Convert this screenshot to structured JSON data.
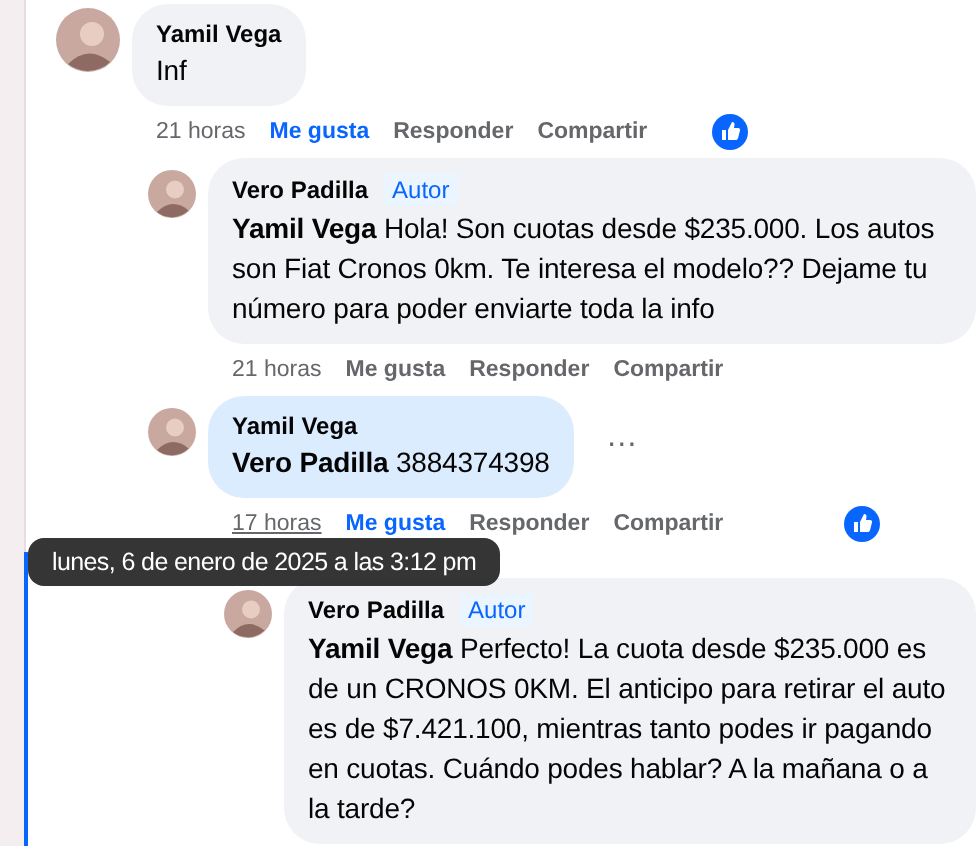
{
  "comments": [
    {
      "author": "Yamil Vega",
      "text": "Inf",
      "highlighted": false,
      "time": "21 horas",
      "time_hovered": false,
      "like": "Me gusta",
      "liked": true,
      "reply": "Responder",
      "share": "Compartir",
      "has_reaction": true,
      "children": [
        {
          "author": "Vero Padilla",
          "badge": "Autor",
          "text": "**Yamil Vega** Hola! Son cuotas desde $235.000. Los autos son Fiat Cronos 0km. Te interesa el modelo?? Dejame tu número para poder enviarte toda la info",
          "highlighted": false,
          "time": "21 horas",
          "time_hovered": false,
          "like": "Me gusta",
          "liked": false,
          "reply": "Responder",
          "share": "Compartir",
          "has_reaction": false
        },
        {
          "author": "Yamil Vega",
          "text": "**Vero Padilla** 3884374398",
          "highlighted": true,
          "time": "17 horas",
          "time_hovered": true,
          "like": "Me gusta",
          "liked": true,
          "reply": "Responder",
          "share": "Compartir",
          "has_reaction": true,
          "menu": "…",
          "children": [
            {
              "author": "Vero Padilla",
              "badge": "Autor",
              "text": "**Yamil Vega** Perfecto! La cuota desde $235.000 es de un CRONOS 0KM. El anticipo para retirar el auto es de $7.421.100, mientras tanto podes ir pagando en cuotas. Cuándo podes hablar? A la mañana o a la tarde?",
              "highlighted": false
            }
          ]
        }
      ]
    }
  ],
  "tooltip": "lunes, 6 de enero de 2025 a las 3:12 pm"
}
